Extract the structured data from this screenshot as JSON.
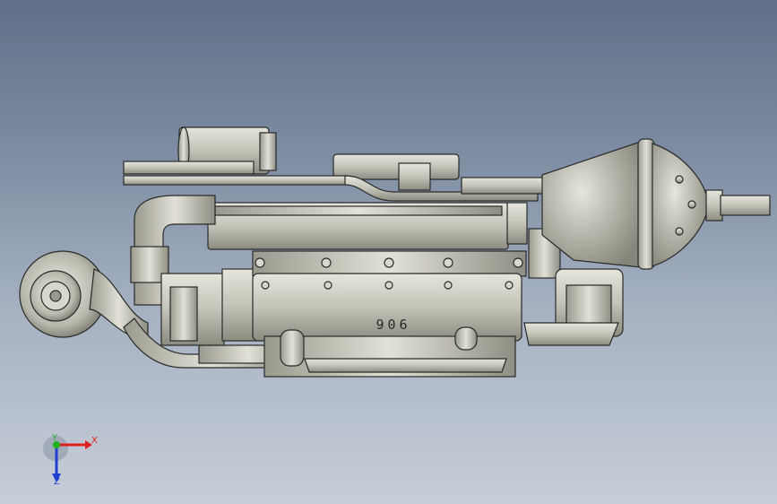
{
  "viewport": {
    "background_top": "#5f7088",
    "background_bottom": "#c7ced8"
  },
  "model": {
    "engraved_text": "906",
    "surface_color": "#c9c8bd",
    "edge_color": "#2a2a2a"
  },
  "triad": {
    "x_label": "X",
    "y_label": "Y",
    "z_label": "Z",
    "x_color": "#e02020",
    "y_color": "#20b020",
    "z_color": "#2040d0"
  }
}
